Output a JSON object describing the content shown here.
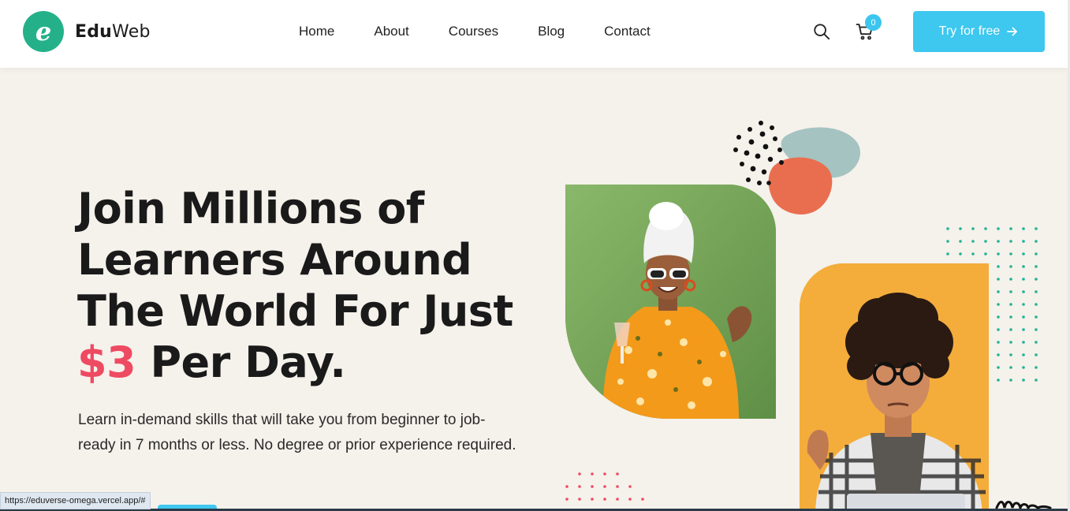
{
  "brand": {
    "logo_letter": "e",
    "name_bold": "Edu",
    "name_light": "Web",
    "accent": "#24b18a"
  },
  "nav": {
    "items": [
      "Home",
      "About",
      "Courses",
      "Blog",
      "Contact"
    ]
  },
  "header": {
    "cart_count": "0",
    "cta_label": "Try for free",
    "cta_color": "#3ec7ef"
  },
  "hero": {
    "title_line1": "Join Millions of",
    "title_line2": "Learners Around",
    "title_line3": "The World For Just",
    "price": "$3",
    "title_line4_rest": " Per Day.",
    "price_color": "#ee4a62",
    "subtitle": "Learn in-demand skills that will take you from beginner to job-ready in 7 months or less. No degree or prior experience required."
  },
  "status_bar": {
    "url": "https://eduverse-omega.vercel.app/#"
  },
  "icons": {
    "search": "search-icon",
    "cart": "cart-icon",
    "arrow": "arrow-right-icon"
  }
}
